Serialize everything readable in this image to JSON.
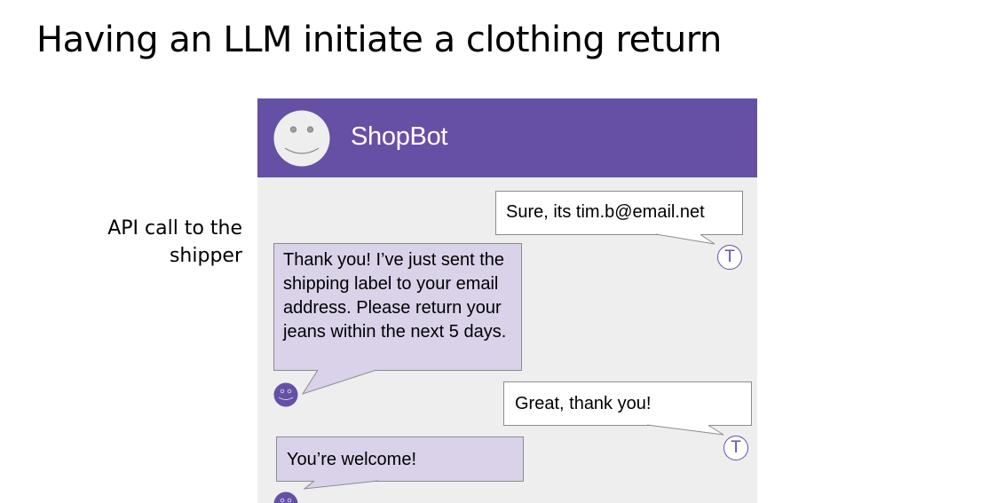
{
  "slide": {
    "title": "Having an LLM initiate a clothing return",
    "side_note": [
      "API call to the",
      "shipper"
    ]
  },
  "chat": {
    "bot_name": "ShopBot",
    "user_initial": "T",
    "messages": [
      {
        "sender": "user",
        "text": "Sure, its tim.b@email.net"
      },
      {
        "sender": "bot",
        "text": "Thank you! I’ve just sent the shipping label to your email address. Please return your jeans within the next 5 days."
      },
      {
        "sender": "user",
        "text": "Great, thank you!"
      },
      {
        "sender": "bot",
        "text": "You’re welcome!"
      }
    ]
  },
  "colors": {
    "header": "#6650a5",
    "bot_bubble": "#d9d2e9",
    "user_bubble": "#ffffff",
    "chat_background": "#eeeeee",
    "avatar_face": "#eeeeee"
  }
}
